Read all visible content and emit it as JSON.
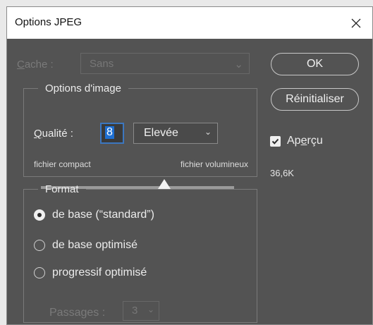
{
  "window": {
    "title": "Options JPEG",
    "close_glyph": "✕"
  },
  "cache": {
    "label_first": "C",
    "label_rest": "ache :",
    "value": "Sans",
    "chevron": "⌄"
  },
  "image_options": {
    "legend": "Options d'image",
    "quality_label_first": "Q",
    "quality_label_rest": "ualité :",
    "quality_value": "8",
    "quality_preset": "Elevée",
    "chevron": "⌄",
    "scale_min_label": "fichier compact",
    "scale_max_label": "fichier volumineux",
    "quality_fraction": 0.64
  },
  "format": {
    "legend": "Format",
    "options": [
      {
        "label": "de base  (“standard”)",
        "selected": true
      },
      {
        "label": "de base optimisé",
        "selected": false
      },
      {
        "label": "progressif optimisé",
        "selected": false
      }
    ],
    "passes_label": "Passages :",
    "passes_value": "3",
    "chevron": "⌄"
  },
  "buttons": {
    "ok": "OK",
    "reset": "Réinitialiser"
  },
  "preview": {
    "label_pre": "Ap",
    "label_u": "e",
    "label_post": "rçu",
    "checked": true,
    "check_glyph": "✓"
  },
  "file_size": "36,6K"
}
